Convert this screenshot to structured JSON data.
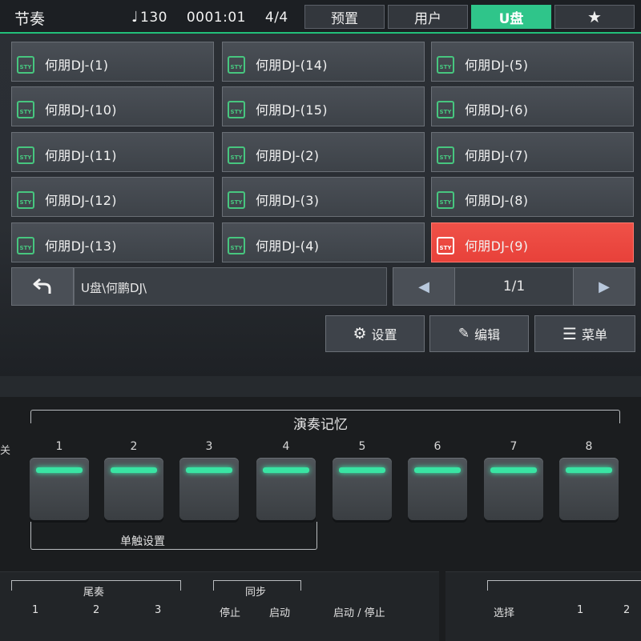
{
  "header": {
    "title": "节奏",
    "tempo_icon": "music-note-icon",
    "tempo": "130",
    "measure": "0001:01",
    "time_signature": "4/4",
    "tabs": [
      {
        "label": "预置"
      },
      {
        "label": "用户"
      },
      {
        "label": "U盘"
      },
      {
        "label": "★"
      }
    ],
    "active_tab": "U盘"
  },
  "files": [
    {
      "label": "何朋DJ-(1)"
    },
    {
      "label": "何朋DJ-(14)"
    },
    {
      "label": "何朋DJ-(5)"
    },
    {
      "label": "何朋DJ-(10)"
    },
    {
      "label": "何朋DJ-(15)"
    },
    {
      "label": "何朋DJ-(6)"
    },
    {
      "label": "何朋DJ-(11)"
    },
    {
      "label": "何朋DJ-(2)"
    },
    {
      "label": "何朋DJ-(7)"
    },
    {
      "label": "何朋DJ-(12)"
    },
    {
      "label": "何朋DJ-(3)"
    },
    {
      "label": "何朋DJ-(8)"
    },
    {
      "label": "何朋DJ-(13)"
    },
    {
      "label": "何朋DJ-(4)"
    },
    {
      "label": "何朋DJ-(9)"
    }
  ],
  "file_icon_text": "STY",
  "selected_file": "何朋DJ-(9)",
  "path": "U盘\\何鹏DJ\\",
  "pager": {
    "page": "1/1"
  },
  "buttons": {
    "settings": "设置",
    "edit": "编辑",
    "menu": "菜单"
  },
  "panel": {
    "memory_title": "演奏记忆",
    "side_label": "关",
    "memory_numbers": [
      "1",
      "2",
      "3",
      "4",
      "5",
      "6",
      "7",
      "8"
    ],
    "single_touch": "单触设置",
    "ending": "尾奏",
    "ending_numbers": [
      "1",
      "2",
      "3"
    ],
    "sync": "同步",
    "sync_stop": "停止",
    "sync_start": "启动",
    "start_stop": "启动 / 停止",
    "select": "选择",
    "right_numbers": [
      "1",
      "2"
    ]
  },
  "colors": {
    "accent": "#2fc58a",
    "selected": "#e8413a",
    "led": "#39e4a3"
  }
}
